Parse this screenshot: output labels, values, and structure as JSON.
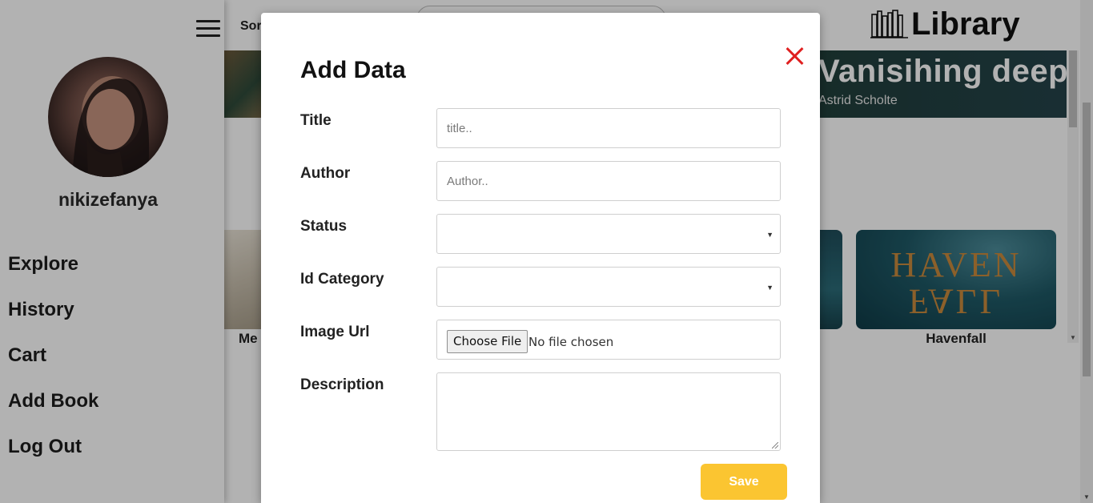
{
  "header": {
    "sort_label": "Sor",
    "logo_text": "Library",
    "logo_icon": "bookshelf-icon",
    "menu_icon": "hamburger-icon"
  },
  "sidebar": {
    "username": "nikizefanya",
    "avatar": "avatar-photo",
    "items": [
      {
        "label": "Explore"
      },
      {
        "label": "History"
      },
      {
        "label": "Cart"
      },
      {
        "label": "Add Book"
      },
      {
        "label": "Log Out"
      }
    ]
  },
  "banner": {
    "title": "Vanisihing deep",
    "author": "Astrid Scholte"
  },
  "books": [
    {
      "label": "Me"
    },
    {
      "label": "Havenfall",
      "cover_lines": [
        "HAVEN",
        "FALL"
      ]
    }
  ],
  "modal": {
    "title": "Add Data",
    "close_icon": "close-icon",
    "fields": {
      "title_label": "Title",
      "title_placeholder": "title..",
      "author_label": "Author",
      "author_placeholder": "Author..",
      "status_label": "Status",
      "status_value": "",
      "category_label": "Id Category",
      "category_value": "",
      "image_label": "Image Url",
      "choose_file_label": "Choose File",
      "file_status": "No file chosen",
      "description_label": "Description"
    },
    "save_label": "Save"
  },
  "colors": {
    "accent": "#fbc531",
    "close": "#e02020"
  }
}
